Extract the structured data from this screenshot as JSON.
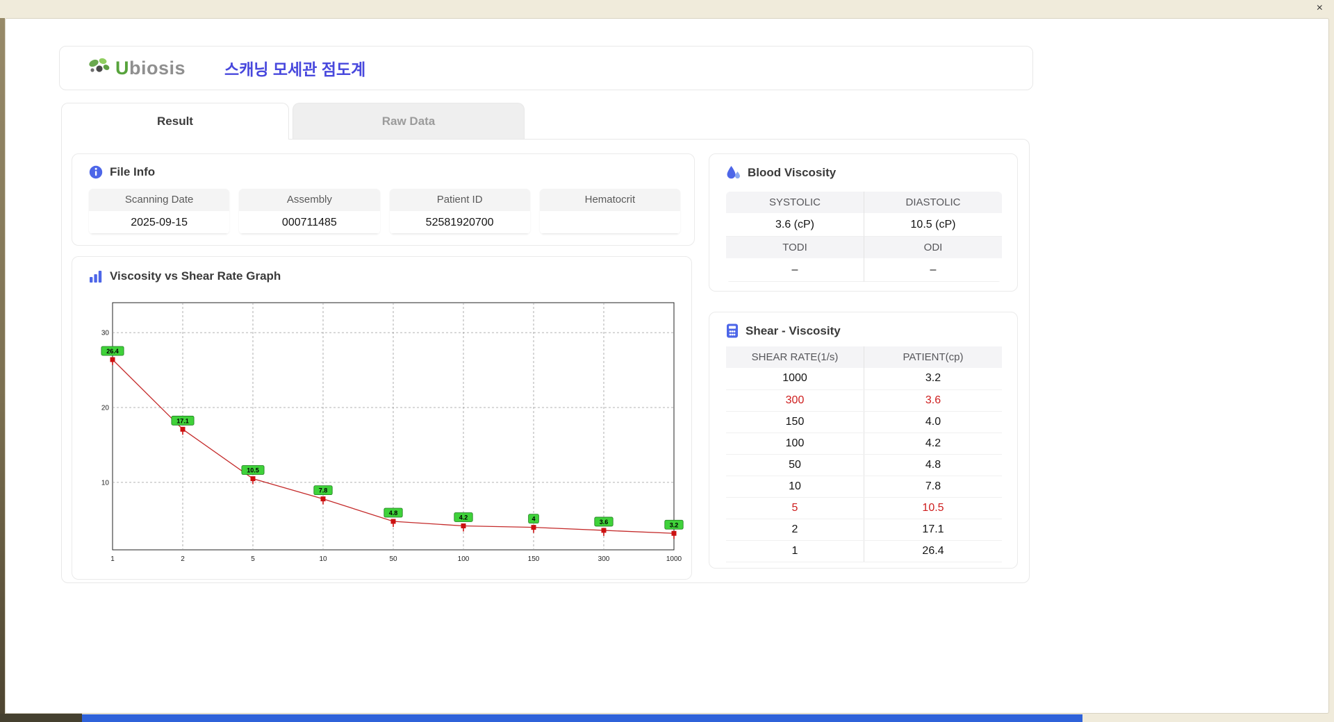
{
  "window": {
    "close_glyph": "×"
  },
  "header": {
    "logo_u": "U",
    "logo_rest": "biosis",
    "title": "스캐닝 모세관 점도계"
  },
  "tabs": [
    {
      "label": "Result"
    },
    {
      "label": "Raw Data"
    }
  ],
  "file_info": {
    "title": "File Info",
    "fields": [
      {
        "label": "Scanning Date",
        "value": "2025-09-15"
      },
      {
        "label": "Assembly",
        "value": "000711485"
      },
      {
        "label": "Patient ID",
        "value": "52581920700"
      },
      {
        "label": "Hematocrit",
        "value": ""
      }
    ]
  },
  "graph": {
    "title": "Viscosity vs Shear Rate Graph"
  },
  "blood_viscosity": {
    "title": "Blood Viscosity",
    "rows": [
      {
        "cells": [
          {
            "label": "SYSTOLIC",
            "value": "3.6 (cP)"
          },
          {
            "label": "DIASTOLIC",
            "value": "10.5 (cP)"
          }
        ]
      },
      {
        "cells": [
          {
            "label": "TODI",
            "value": "–"
          },
          {
            "label": "ODI",
            "value": "–"
          }
        ]
      }
    ]
  },
  "shear_viscosity": {
    "title": "Shear - Viscosity",
    "columns": [
      "SHEAR RATE(1/s)",
      "PATIENT(cp)"
    ],
    "rows": [
      {
        "rate": "1000",
        "patient": "3.2",
        "highlight": false
      },
      {
        "rate": "300",
        "patient": "3.6",
        "highlight": true
      },
      {
        "rate": "150",
        "patient": "4.0",
        "highlight": false
      },
      {
        "rate": "100",
        "patient": "4.2",
        "highlight": false
      },
      {
        "rate": "50",
        "patient": "4.8",
        "highlight": false
      },
      {
        "rate": "10",
        "patient": "7.8",
        "highlight": false
      },
      {
        "rate": "5",
        "patient": "10.5",
        "highlight": true
      },
      {
        "rate": "2",
        "patient": "17.1",
        "highlight": false
      },
      {
        "rate": "1",
        "patient": "26.4",
        "highlight": false
      }
    ]
  },
  "chart_data": {
    "type": "line",
    "title": "Viscosity vs Shear Rate Graph",
    "categories": [
      "1",
      "2",
      "5",
      "10",
      "50",
      "100",
      "150",
      "300",
      "1000"
    ],
    "values": [
      26.4,
      17.1,
      10.5,
      7.8,
      4.8,
      4.2,
      4,
      3.6,
      3.2
    ],
    "point_labels": [
      "26.4",
      "17.1",
      "10.5",
      "7.8",
      "4.8",
      "4.2",
      "4",
      "3.6",
      "3.2"
    ],
    "xlabel": "",
    "ylabel": "",
    "yticks": [
      10,
      20,
      30
    ],
    "ylim": [
      1,
      34
    ],
    "x_axis_type": "category",
    "grid": true,
    "legend": false,
    "line_color": "#c42a2a",
    "marker_color": "#cc1111",
    "label_fill": "#3fd23a",
    "label_border": "#1d7a1d"
  },
  "colors": {
    "accent_blue": "#4d66e8",
    "title_blue": "#4848dd",
    "highlight_red": "#ce1d1d",
    "logo_green": "#57a33c"
  }
}
